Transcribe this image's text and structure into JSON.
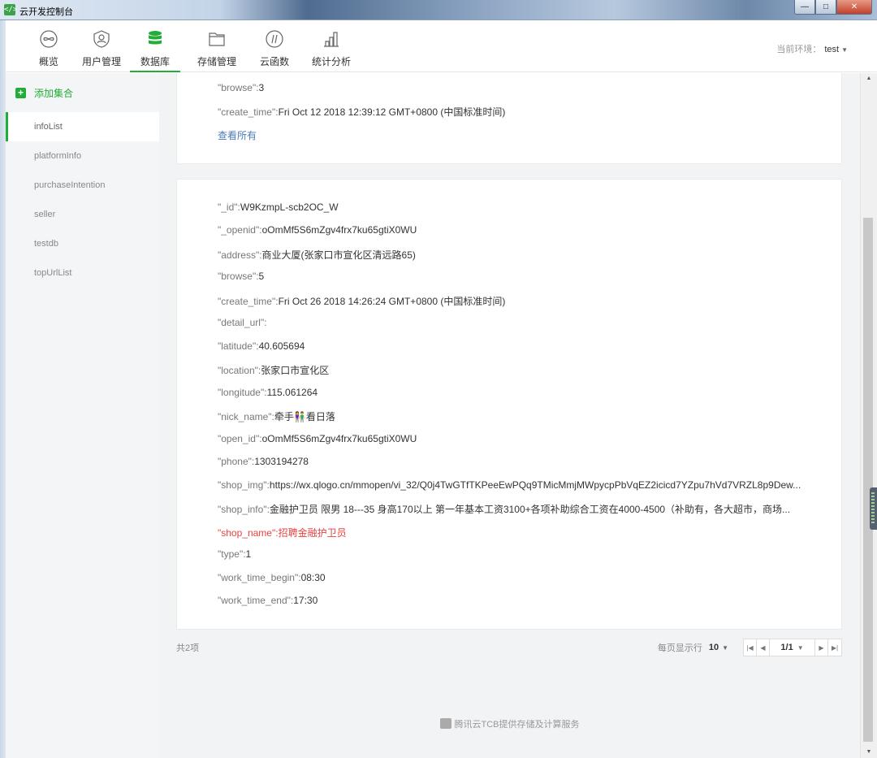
{
  "window": {
    "title": "云开发控制台",
    "minimize": "—",
    "maximize": "□",
    "close": "✕"
  },
  "nav": {
    "items": [
      {
        "label": "概览",
        "icon": "infinity-icon"
      },
      {
        "label": "用户管理",
        "icon": "user-icon"
      },
      {
        "label": "数据库",
        "icon": "database-icon",
        "active": true
      },
      {
        "label": "存储管理",
        "icon": "folder-icon"
      },
      {
        "label": "云函数",
        "icon": "function-icon"
      },
      {
        "label": "统计分析",
        "icon": "bar-chart-icon"
      }
    ],
    "env_label": "当前环境：",
    "env_value": "test"
  },
  "sidebar": {
    "add_label": "添加集合",
    "collections": [
      "infoList",
      "platformInfo",
      "purchaseIntention",
      "seller",
      "testdb",
      "topUrlList"
    ],
    "active": "infoList"
  },
  "record1": {
    "fields": [
      {
        "key": "\"browse\":",
        "value": "3"
      },
      {
        "key": "\"create_time\":",
        "value": "Fri Oct 12 2018 12:39:12 GMT+0800 (中国标准时间)"
      }
    ],
    "view_all": "查看所有"
  },
  "record2": {
    "fields": [
      {
        "key": "\"_id\":",
        "value": "W9KzmpL-scb2OC_W"
      },
      {
        "key": "\"_openid\":",
        "value": "oOmMf5S6mZgv4frx7ku65gtiX0WU"
      },
      {
        "key": "\"address\":",
        "value": "商业大厦(张家口市宣化区清远路65)"
      },
      {
        "key": "\"browse\":",
        "value": "5"
      },
      {
        "key": "\"create_time\":",
        "value": "Fri Oct 26 2018 14:26:24 GMT+0800 (中国标准时间)"
      },
      {
        "key": "\"detail_url\":",
        "value": ""
      },
      {
        "key": "\"latitude\":",
        "value": "40.605694"
      },
      {
        "key": "\"location\":",
        "value": "张家口市宣化区"
      },
      {
        "key": "\"longitude\":",
        "value": "115.061264"
      },
      {
        "key": "\"nick_name\":",
        "value": "牵手👫看日落"
      },
      {
        "key": "\"open_id\":",
        "value": "oOmMf5S6mZgv4frx7ku65gtiX0WU"
      },
      {
        "key": "\"phone\":",
        "value": "1303194278"
      },
      {
        "key": "\"shop_img\":",
        "value": "https://wx.qlogo.cn/mmopen/vi_32/Q0j4TwGTfTKPeeEwPQq9TMicMmjMWpycpPbVqEZ2icicd7YZpu7hVd7VRZL8p9Dew..."
      },
      {
        "key": "\"shop_info\":",
        "value": "金融护卫员 限男 18---35 身高170以上 第一年基本工资3100+各项补助综合工资在4000-4500（补助有，各大超市，商场..."
      },
      {
        "key": "\"shop_name\":",
        "value": "招聘金融护卫员",
        "highlight": true
      },
      {
        "key": "\"type\":",
        "value": "1"
      },
      {
        "key": "\"work_time_begin\":",
        "value": "08:30"
      },
      {
        "key": "\"work_time_end\":",
        "value": "17:30"
      }
    ]
  },
  "pagination": {
    "total": "共2项",
    "per_page_label": "每页显示行",
    "per_page": "10",
    "page": "1/1"
  },
  "footer": {
    "text": "腾讯云TCB提供存储及计算服务"
  },
  "colors": {
    "accent": "#22ac38",
    "link": "#4a7bb7",
    "highlight": "#e64340"
  }
}
